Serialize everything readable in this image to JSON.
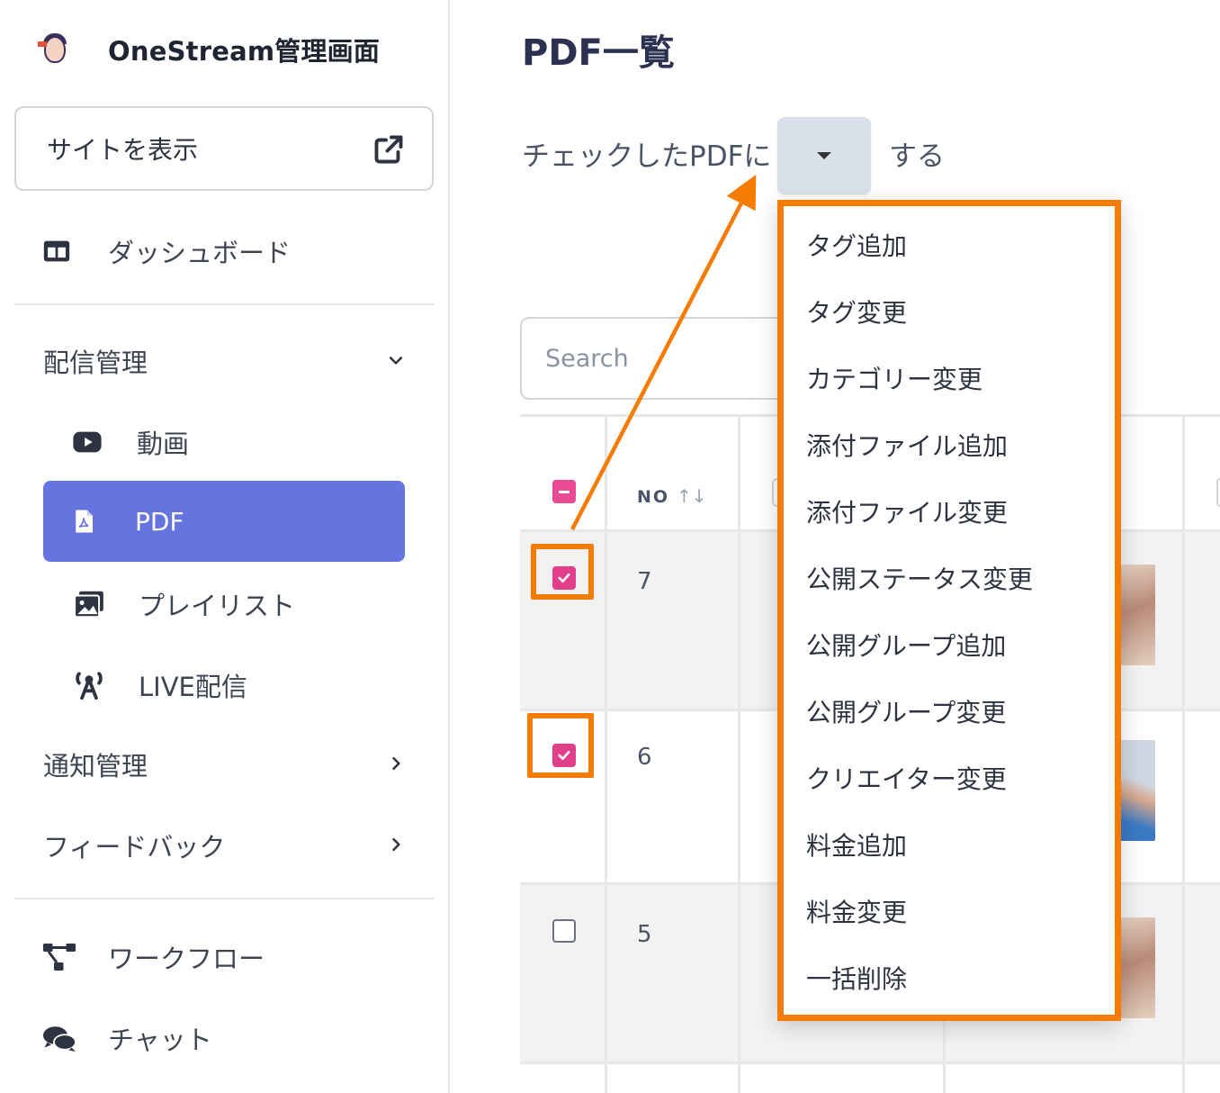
{
  "app": {
    "title": "OneStream管理画面"
  },
  "sidebar": {
    "site_button": "サイトを表示",
    "dashboard": "ダッシュボード",
    "section_delivery": "配信管理",
    "items": {
      "video": "動画",
      "pdf": "PDF",
      "playlist": "プレイリスト",
      "live": "LIVE配信"
    },
    "section_notification": "通知管理",
    "section_feedback": "フィードバック",
    "workflow": "ワークフロー",
    "chat": "チャット"
  },
  "main": {
    "page_title": "PDF一覧",
    "bulk_prefix": "チェックしたPDFに",
    "bulk_suffix": "する",
    "search_placeholder": "Search",
    "table": {
      "no_header": "NO",
      "sort_icon": "↑↓",
      "rows": [
        {
          "no": "7",
          "checked": true
        },
        {
          "no": "6",
          "checked": true
        },
        {
          "no": "5",
          "checked": false
        }
      ]
    }
  },
  "dropdown": {
    "items": [
      "タグ追加",
      "タグ変更",
      "カテゴリー変更",
      "添付ファイル追加",
      "添付ファイル変更",
      "公開ステータス変更",
      "公開グループ追加",
      "公開グループ変更",
      "クリエイター変更",
      "料金追加",
      "料金変更",
      "一括削除"
    ]
  },
  "colors": {
    "accent": "#6574df",
    "highlight": "#f57c00",
    "checkbox": "#e23f8a"
  },
  "icons": [
    "external-link-icon",
    "dashboard-icon",
    "youtube-icon",
    "pdf-icon",
    "playlist-icon",
    "live-icon",
    "workflow-icon",
    "chat-icon",
    "chevron-down-icon",
    "chevron-right-icon"
  ]
}
